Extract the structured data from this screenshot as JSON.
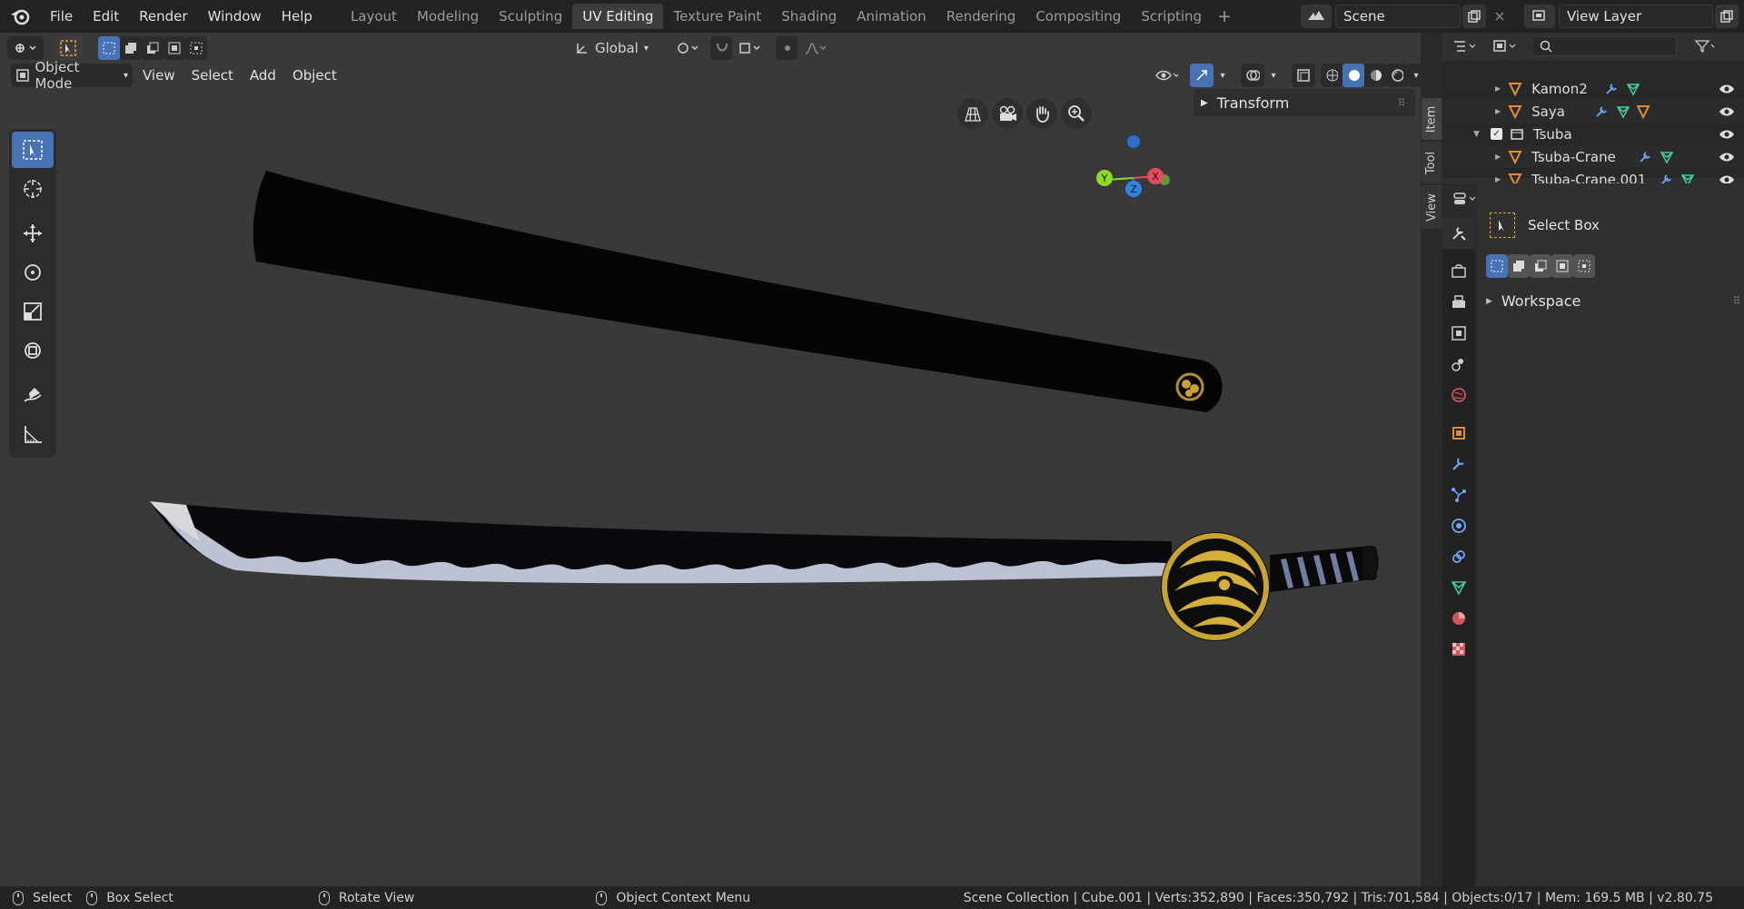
{
  "topbar": {
    "menus": [
      "File",
      "Edit",
      "Render",
      "Window",
      "Help"
    ],
    "workspaces": [
      "Layout",
      "Modeling",
      "Sculpting",
      "UV Editing",
      "Texture Paint",
      "Shading",
      "Animation",
      "Rendering",
      "Compositing",
      "Scripting"
    ],
    "active_workspace": "UV Editing",
    "scene_label": "Scene",
    "view_layer_label": "View Layer"
  },
  "viewport_header": {
    "transform_orientation": "Global",
    "mode": "Object Mode",
    "menus": [
      "View",
      "Select",
      "Add",
      "Object"
    ]
  },
  "npanel": {
    "transform_label": "Transform",
    "tabs": [
      "Item",
      "Tool",
      "View"
    ]
  },
  "gizmo": {
    "x": "X",
    "y": "Y",
    "z": "Z"
  },
  "outliner": {
    "rows": [
      {
        "label": "Kamon2",
        "depth": 1
      },
      {
        "label": "Saya",
        "depth": 1
      },
      {
        "label": "Tsuba",
        "depth": 0
      },
      {
        "label": "Tsuba-Crane",
        "depth": 1
      },
      {
        "label": "Tsuba-Crane.001",
        "depth": 1
      }
    ]
  },
  "properties": {
    "tool_name": "Select Box",
    "workspace_label": "Workspace"
  },
  "statusbar": {
    "select": "Select",
    "box_select": "Box Select",
    "rotate_view": "Rotate View",
    "context_menu": "Object Context Menu",
    "stats": "Scene Collection | Cube.001 | Verts:352,890 | Faces:350,792 | Tris:701,584 | Objects:0/17 | Mem: 169.5 MB | v2.80.75"
  },
  "colors": {
    "accent": "#4772b3",
    "object_orange": "#e38b3a",
    "mesh_green": "#3dcf9f",
    "modifier_blue": "#6fa8ff"
  }
}
